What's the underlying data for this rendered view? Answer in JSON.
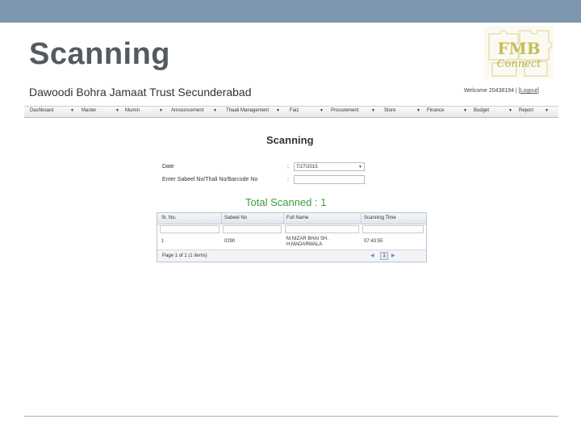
{
  "slide": {
    "title": "Scanning"
  },
  "logo": {
    "line1": "FMB",
    "line2": "Connect"
  },
  "app": {
    "name": "Dawoodi Bohra Jamaat Trust Secunderabad",
    "welcome_prefix": "Welcome 20438194 | [",
    "logout_label": "Logout",
    "welcome_suffix": "]"
  },
  "nav": {
    "items": [
      {
        "label": "Dashboard"
      },
      {
        "label": "Master"
      },
      {
        "label": "Mumin"
      },
      {
        "label": "Announcement"
      },
      {
        "label": "Thaali Management"
      },
      {
        "label": "Faiz"
      },
      {
        "label": "Procurement"
      },
      {
        "label": "Store"
      },
      {
        "label": "Finance"
      },
      {
        "label": "Budget"
      },
      {
        "label": "Report"
      }
    ]
  },
  "page": {
    "heading": "Scanning",
    "date_label": "Date",
    "date_value": "7/27/2015",
    "sabeel_label": "Enter Sabeel No/Thali No/Barcode No",
    "sabeel_value": "",
    "total_label": "Total Scanned : 1"
  },
  "grid": {
    "columns": [
      "Sr. No.",
      "Sabeel No",
      "Full Name",
      "Scanning Time"
    ],
    "rows": [
      {
        "sr": "1",
        "sabeel": "0290",
        "name_line1": "M.NIZAR BHAI SH.",
        "name_line2": "H.MADARWALA",
        "time": "07:43:55"
      }
    ],
    "footer_text": "Page 1 of 1 (1 items)",
    "current_page": "1"
  },
  "colors": {
    "topbar": "#7d95ad",
    "total_text": "#3e9a3e",
    "title_text": "#545a5f"
  }
}
